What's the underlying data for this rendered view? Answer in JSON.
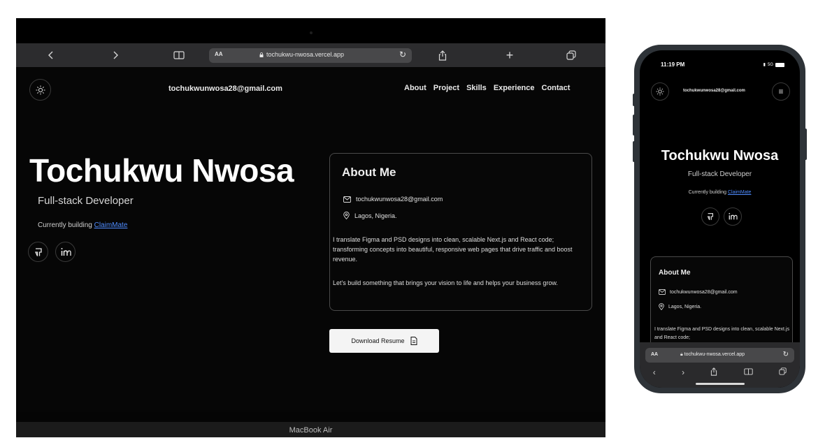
{
  "browser": {
    "text_size_label": "AA",
    "url": "tochukwu-nwosa.vercel.app"
  },
  "site": {
    "email": "tochukwunwosa28@gmail.com",
    "nav": [
      "About",
      "Project",
      "Skills",
      "Experience",
      "Contact"
    ],
    "name": "Tochukwu Nwosa",
    "role": "Full-stack Developer",
    "building_prefix": "Currently building ",
    "building_link": "ClaimMate",
    "about": {
      "title": "About Me",
      "email": "tochukwunwosa28@gmail.com",
      "location": "Lagos, Nigeria.",
      "paragraph1": "I translate Figma and PSD designs into clean, scalable Next.js and React code; transforming concepts into beautiful, responsive web pages that drive traffic and boost revenue.",
      "paragraph2": "Let's build something that brings your vision to life and helps your business grow.",
      "paragraph1_mobile": "I translate Figma and PSD designs into clean, scalable Next.js and React code;"
    },
    "download_label": "Download Resume"
  },
  "laptop": {
    "model_label": "MacBook Air"
  },
  "phone": {
    "time": "11:19 PM",
    "signal": "5G",
    "text_size_label": "AA",
    "url": "tochukwu-nwosa.vercel.app"
  },
  "colors": {
    "background": "#060606",
    "link": "#4f8cff",
    "button_bg": "#f4f4f4"
  }
}
